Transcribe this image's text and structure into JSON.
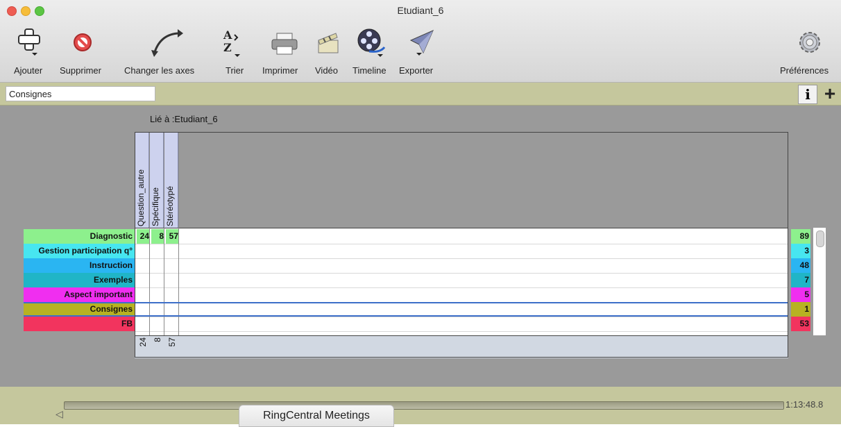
{
  "window": {
    "title": "Etudiant_6",
    "traffic_lights": {
      "close": "#ee5d53",
      "minimize": "#f6bd3a",
      "zoom": "#5cc544"
    }
  },
  "toolbar": {
    "add_label": "Ajouter",
    "delete_label": "Supprimer",
    "change_axes_label": "Changer les axes",
    "sort_label": "Trier",
    "print_label": "Imprimer",
    "video_label": "Vidéo",
    "timeline_label": "Timeline",
    "export_label": "Exporter",
    "preferences_label": "Préférences"
  },
  "filter": {
    "field_value": "Consignes"
  },
  "grid": {
    "linked_to": "Lié à :Etudiant_6",
    "columns": [
      "Question_autre",
      "Spécifique",
      "Stéréotypé"
    ],
    "rows": [
      {
        "label": "Diagnostic",
        "color": "#8df08d",
        "cells": [
          "24",
          "8",
          "57"
        ],
        "total": "89"
      },
      {
        "label": "Gestion participation q°",
        "color": "#47e6f0",
        "cells": [
          "",
          "",
          ""
        ],
        "total": "3"
      },
      {
        "label": "Instruction",
        "color": "#2ab5f2",
        "cells": [
          "",
          "",
          ""
        ],
        "total": "48"
      },
      {
        "label": "Exemples",
        "color": "#20b5c7",
        "cells": [
          "",
          "",
          ""
        ],
        "total": "7"
      },
      {
        "label": "Aspect important",
        "color": "#f02ef0",
        "cells": [
          "",
          "",
          ""
        ],
        "total": "5"
      },
      {
        "label": "Consignes",
        "color": "#b7b222",
        "cells": [
          "",
          "",
          ""
        ],
        "total": "1"
      },
      {
        "label": "FB",
        "color": "#f2345e",
        "cells": [
          "",
          "",
          ""
        ],
        "total": "53"
      }
    ],
    "column_totals": [
      "24",
      "8",
      "57"
    ]
  },
  "timeline": {
    "time": "1:13:48.8"
  },
  "dock": {
    "app_label": "RingCentral Meetings"
  }
}
